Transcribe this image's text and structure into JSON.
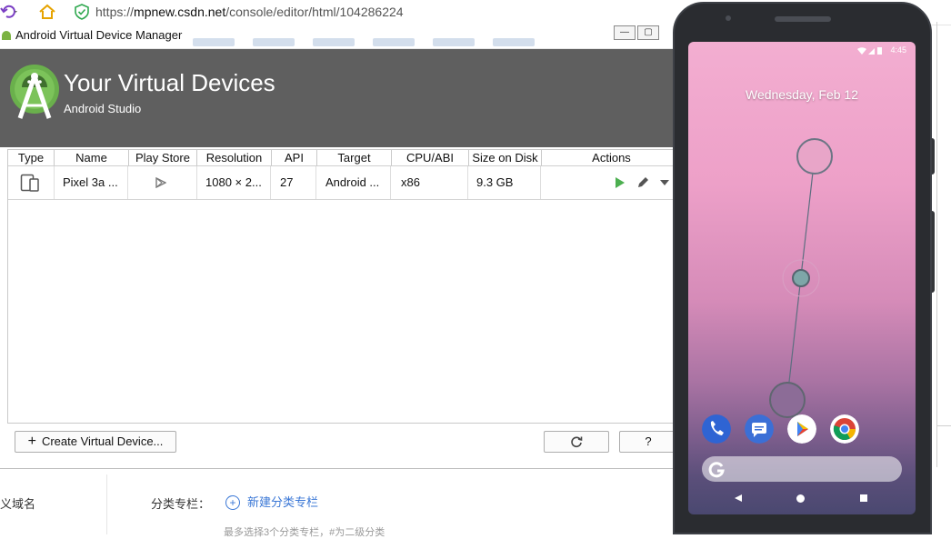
{
  "browser": {
    "url_scheme": "https://",
    "url_host": "mpnew.csdn.net",
    "url_path": "/console/editor/html/104286224"
  },
  "avd": {
    "window_title": "Android Virtual Device Manager",
    "header_title": "Your Virtual Devices",
    "header_subtitle": "Android Studio",
    "columns": [
      "Type",
      "Name",
      "Play Store",
      "Resolution",
      "API",
      "Target",
      "CPU/ABI",
      "Size on Disk",
      "Actions"
    ],
    "device": {
      "name": "Pixel 3a ...",
      "resolution": "1080 × 2...",
      "api": "27",
      "target": "Android ...",
      "cpu": "x86",
      "size": "9.3 GB"
    },
    "create_label": "Create Virtual Device...",
    "help_label": "?"
  },
  "web": {
    "sidebar_item": "义域名",
    "category_label": "分类专栏：",
    "add_category": "新建分类专栏",
    "hint": "最多选择3个分类专栏，#为二级分类"
  },
  "phone": {
    "time": "4:45",
    "date": "Wednesday, Feb 12"
  },
  "colors": {
    "header_bg": "#5f5f5f",
    "accent_green": "#3ddc84",
    "link_blue": "#3a77d6"
  }
}
